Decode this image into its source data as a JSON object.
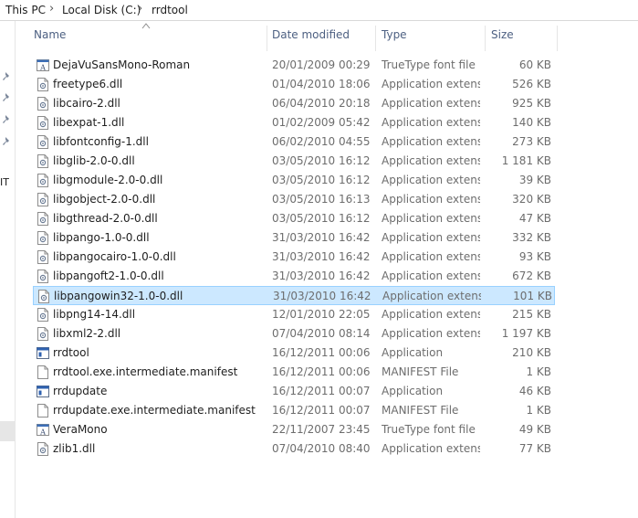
{
  "breadcrumb": [
    "This PC",
    "Local Disk (C:)",
    "rrdtool"
  ],
  "nav": {
    "partial_label": "IT"
  },
  "columns": {
    "name": "Name",
    "date": "Date modified",
    "type": "Type",
    "size": "Size"
  },
  "files": [
    {
      "name": "DejaVuSansMono-Roman",
      "date": "20/01/2009 00:29",
      "type": "TrueType font file",
      "size": "60 KB",
      "icon": "font-file-icon"
    },
    {
      "name": "freetype6.dll",
      "date": "01/04/2010 18:06",
      "type": "Application extens...",
      "size": "526 KB",
      "icon": "dll-file-icon"
    },
    {
      "name": "libcairo-2.dll",
      "date": "06/04/2010 20:18",
      "type": "Application extens...",
      "size": "925 KB",
      "icon": "dll-file-icon"
    },
    {
      "name": "libexpat-1.dll",
      "date": "01/02/2009 05:42",
      "type": "Application extens...",
      "size": "140 KB",
      "icon": "dll-file-icon"
    },
    {
      "name": "libfontconfig-1.dll",
      "date": "06/02/2010 04:55",
      "type": "Application extens...",
      "size": "273 KB",
      "icon": "dll-file-icon"
    },
    {
      "name": "libglib-2.0-0.dll",
      "date": "03/05/2010 16:12",
      "type": "Application extens...",
      "size": "1 181 KB",
      "icon": "dll-file-icon"
    },
    {
      "name": "libgmodule-2.0-0.dll",
      "date": "03/05/2010 16:12",
      "type": "Application extens...",
      "size": "39 KB",
      "icon": "dll-file-icon"
    },
    {
      "name": "libgobject-2.0-0.dll",
      "date": "03/05/2010 16:13",
      "type": "Application extens...",
      "size": "320 KB",
      "icon": "dll-file-icon"
    },
    {
      "name": "libgthread-2.0-0.dll",
      "date": "03/05/2010 16:12",
      "type": "Application extens...",
      "size": "47 KB",
      "icon": "dll-file-icon"
    },
    {
      "name": "libpango-1.0-0.dll",
      "date": "31/03/2010 16:42",
      "type": "Application extens...",
      "size": "332 KB",
      "icon": "dll-file-icon"
    },
    {
      "name": "libpangocairo-1.0-0.dll",
      "date": "31/03/2010 16:42",
      "type": "Application extens...",
      "size": "93 KB",
      "icon": "dll-file-icon"
    },
    {
      "name": "libpangoft2-1.0-0.dll",
      "date": "31/03/2010 16:42",
      "type": "Application extens...",
      "size": "672 KB",
      "icon": "dll-file-icon"
    },
    {
      "name": "libpangowin32-1.0-0.dll",
      "date": "31/03/2010 16:42",
      "type": "Application extens...",
      "size": "101 KB",
      "icon": "dll-file-icon",
      "selected": true
    },
    {
      "name": "libpng14-14.dll",
      "date": "12/01/2010 22:05",
      "type": "Application extens...",
      "size": "215 KB",
      "icon": "dll-file-icon"
    },
    {
      "name": "libxml2-2.dll",
      "date": "07/04/2010 08:14",
      "type": "Application extens...",
      "size": "1 197 KB",
      "icon": "dll-file-icon"
    },
    {
      "name": "rrdtool",
      "date": "16/12/2011 00:06",
      "type": "Application",
      "size": "210 KB",
      "icon": "application-icon"
    },
    {
      "name": "rrdtool.exe.intermediate.manifest",
      "date": "16/12/2011 00:06",
      "type": "MANIFEST File",
      "size": "1 KB",
      "icon": "blank-file-icon"
    },
    {
      "name": "rrdupdate",
      "date": "16/12/2011 00:07",
      "type": "Application",
      "size": "46 KB",
      "icon": "application-icon"
    },
    {
      "name": "rrdupdate.exe.intermediate.manifest",
      "date": "16/12/2011 00:07",
      "type": "MANIFEST File",
      "size": "1 KB",
      "icon": "blank-file-icon"
    },
    {
      "name": "VeraMono",
      "date": "22/11/2007 23:45",
      "type": "TrueType font file",
      "size": "49 KB",
      "icon": "font-file-icon"
    },
    {
      "name": "zlib1.dll",
      "date": "07/04/2010 08:40",
      "type": "Application extens...",
      "size": "77 KB",
      "icon": "dll-file-icon"
    }
  ],
  "colors": {
    "selected_bg": "#cce8ff",
    "selected_border": "#99d1ff",
    "header_text": "#4d6082"
  }
}
